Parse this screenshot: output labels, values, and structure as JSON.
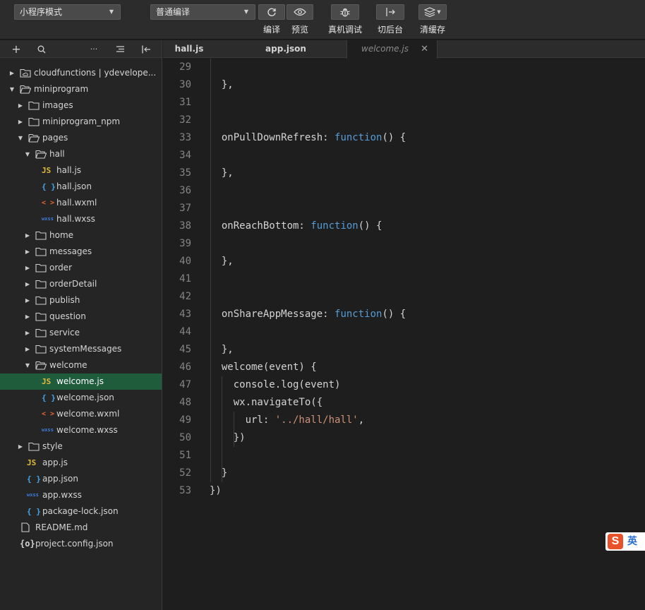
{
  "toolbar": {
    "mode_select": "小程序模式",
    "compile_select": "普通编译",
    "compile_label": "编译",
    "preview_label": "预览",
    "remote_debug_label": "真机调试",
    "background_label": "切后台",
    "clear_cache_label": "清缓存"
  },
  "sidebar": {
    "tools": [
      "+",
      "search-icon",
      "···",
      "sort-icon",
      "collapse-icon"
    ],
    "tree": [
      {
        "label": "cloudfunctions | ydevelope...",
        "type": "cloud-folder",
        "depth": 0,
        "expanded": false
      },
      {
        "label": "miniprogram",
        "type": "folder",
        "depth": 0,
        "expanded": true
      },
      {
        "label": "images",
        "type": "folder",
        "depth": 1,
        "expanded": false
      },
      {
        "label": "miniprogram_npm",
        "type": "folder",
        "depth": 1,
        "expanded": false
      },
      {
        "label": "pages",
        "type": "folder",
        "depth": 1,
        "expanded": true
      },
      {
        "label": "hall",
        "type": "folder",
        "depth": 2,
        "expanded": true
      },
      {
        "label": "hall.js",
        "type": "js",
        "depth": 3
      },
      {
        "label": "hall.json",
        "type": "json",
        "depth": 3
      },
      {
        "label": "hall.wxml",
        "type": "wxml",
        "depth": 3
      },
      {
        "label": "hall.wxss",
        "type": "wxss",
        "depth": 3
      },
      {
        "label": "home",
        "type": "folder",
        "depth": 2,
        "expanded": false
      },
      {
        "label": "messages",
        "type": "folder",
        "depth": 2,
        "expanded": false
      },
      {
        "label": "order",
        "type": "folder",
        "depth": 2,
        "expanded": false
      },
      {
        "label": "orderDetail",
        "type": "folder",
        "depth": 2,
        "expanded": false
      },
      {
        "label": "publish",
        "type": "folder",
        "depth": 2,
        "expanded": false
      },
      {
        "label": "question",
        "type": "folder",
        "depth": 2,
        "expanded": false
      },
      {
        "label": "service",
        "type": "folder",
        "depth": 2,
        "expanded": false
      },
      {
        "label": "systemMessages",
        "type": "folder",
        "depth": 2,
        "expanded": false
      },
      {
        "label": "welcome",
        "type": "folder",
        "depth": 2,
        "expanded": true
      },
      {
        "label": "welcome.js",
        "type": "js",
        "depth": 3,
        "selected": true
      },
      {
        "label": "welcome.json",
        "type": "json",
        "depth": 3
      },
      {
        "label": "welcome.wxml",
        "type": "wxml",
        "depth": 3
      },
      {
        "label": "welcome.wxss",
        "type": "wxss",
        "depth": 3
      },
      {
        "label": "style",
        "type": "folder",
        "depth": 1,
        "expanded": false
      },
      {
        "label": "app.js",
        "type": "js",
        "depth": 1
      },
      {
        "label": "app.json",
        "type": "json",
        "depth": 1
      },
      {
        "label": "app.wxss",
        "type": "wxss",
        "depth": 1
      },
      {
        "label": "package-lock.json",
        "type": "json",
        "depth": 1
      },
      {
        "label": "README.md",
        "type": "md",
        "depth": 0
      },
      {
        "label": "project.config.json",
        "type": "config",
        "depth": 0
      }
    ],
    "icon_text": {
      "js": "JS",
      "json": "{ }",
      "wxml": "< >",
      "wxss": "wxss",
      "config": "{o}"
    }
  },
  "tabs": [
    {
      "label": "hall.js",
      "active": false
    },
    {
      "label": "app.json",
      "active": false
    },
    {
      "label": "welcome.js",
      "active": true,
      "close": "✕"
    }
  ],
  "editor": {
    "lines": [
      {
        "n": "29",
        "tokens": []
      },
      {
        "n": "30",
        "tokens": [
          [
            "p",
            "  },"
          ]
        ]
      },
      {
        "n": "31",
        "tokens": []
      },
      {
        "n": "32",
        "tokens": []
      },
      {
        "n": "33",
        "tokens": [
          [
            "p",
            "  onPullDownRefresh: "
          ],
          [
            "kw",
            "function"
          ],
          [
            "p",
            "() {"
          ]
        ]
      },
      {
        "n": "34",
        "tokens": []
      },
      {
        "n": "35",
        "tokens": [
          [
            "p",
            "  },"
          ]
        ]
      },
      {
        "n": "36",
        "tokens": []
      },
      {
        "n": "37",
        "tokens": []
      },
      {
        "n": "38",
        "tokens": [
          [
            "p",
            "  onReachBottom: "
          ],
          [
            "kw",
            "function"
          ],
          [
            "p",
            "() {"
          ]
        ]
      },
      {
        "n": "39",
        "tokens": []
      },
      {
        "n": "40",
        "tokens": [
          [
            "p",
            "  },"
          ]
        ]
      },
      {
        "n": "41",
        "tokens": []
      },
      {
        "n": "42",
        "tokens": []
      },
      {
        "n": "43",
        "tokens": [
          [
            "p",
            "  onShareAppMessage: "
          ],
          [
            "kw",
            "function"
          ],
          [
            "p",
            "() {"
          ]
        ]
      },
      {
        "n": "44",
        "tokens": []
      },
      {
        "n": "45",
        "tokens": [
          [
            "p",
            "  },"
          ]
        ]
      },
      {
        "n": "46",
        "tokens": [
          [
            "p",
            "  welcome(event) {"
          ]
        ]
      },
      {
        "n": "47",
        "tokens": [
          [
            "p",
            "    console.log(event)"
          ]
        ]
      },
      {
        "n": "48",
        "tokens": [
          [
            "p",
            "    wx.navigateTo({"
          ]
        ]
      },
      {
        "n": "49",
        "tokens": [
          [
            "p",
            "      url: "
          ],
          [
            "str",
            "'../hall/hall'"
          ],
          [
            "p",
            ","
          ]
        ]
      },
      {
        "n": "50",
        "tokens": [
          [
            "p",
            "    })"
          ]
        ]
      },
      {
        "n": "51",
        "tokens": []
      },
      {
        "n": "52",
        "tokens": [
          [
            "p",
            "  }"
          ]
        ]
      },
      {
        "n": "53",
        "tokens": [
          [
            "p",
            "})"
          ]
        ]
      }
    ]
  },
  "ime": {
    "logo": "S",
    "lang": "英"
  },
  "colors": {
    "selected_row": "#1f5c3c",
    "keyword": "#569cd6",
    "string": "#ce9178"
  }
}
